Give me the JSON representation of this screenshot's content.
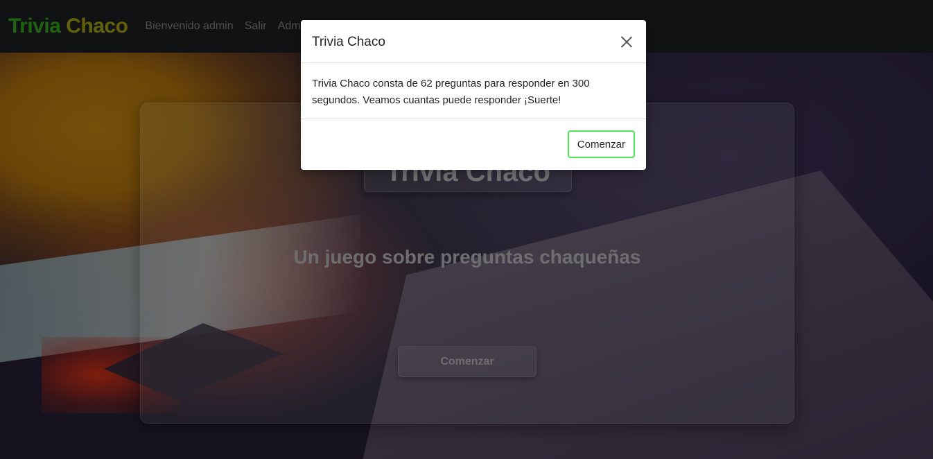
{
  "navbar": {
    "brand_word1": "Trivia",
    "brand_word2": "Chaco",
    "brand_colors": [
      "#3cc61e",
      "#c9c21a"
    ],
    "links": [
      "Bienvenido admin",
      "Salir",
      "Adm"
    ]
  },
  "card": {
    "title": "Trivia Chaco",
    "subtitle": "Un juego sobre preguntas chaqueñas",
    "button_label": "Comenzar"
  },
  "modal": {
    "title": "Trivia Chaco",
    "close_icon": "close-icon",
    "body": "Trivia Chaco consta de 62 preguntas para responder en 300 segundos. Veamos cuantas puede responder ¡Suerte!",
    "button_label": "Comenzar",
    "button_border_color": "#4ee84e"
  }
}
